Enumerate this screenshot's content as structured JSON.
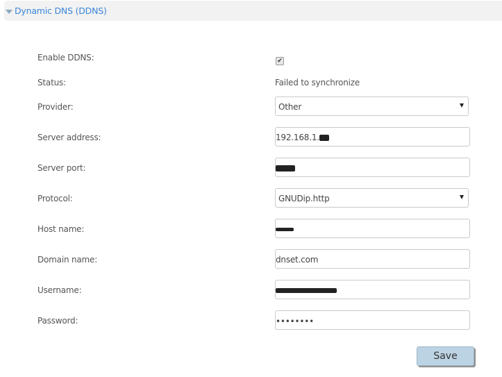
{
  "section": {
    "title": "Dynamic DNS (DDNS)",
    "expanded": true
  },
  "form": {
    "enable_ddns": {
      "label": "Enable DDNS:",
      "checked": true,
      "check_glyph": "✔"
    },
    "status": {
      "label": "Status:",
      "value": "Failed to synchronize"
    },
    "provider": {
      "label": "Provider:",
      "value": "Other"
    },
    "server_address": {
      "label": "Server address:",
      "value": "192.168.1.",
      "redacted_suffix": true
    },
    "server_port": {
      "label": "Server port:",
      "value": "",
      "redacted": true
    },
    "protocol": {
      "label": "Protocol:",
      "value": "GNUDip.http"
    },
    "host_name": {
      "label": "Host name:",
      "value": "",
      "redacted": true
    },
    "domain_name": {
      "label": "Domain name:",
      "value": "dnset.com"
    },
    "username": {
      "label": "Username:",
      "value": "",
      "redacted": true
    },
    "password": {
      "label": "Password:",
      "value": "••••••••"
    }
  },
  "actions": {
    "save_label": "Save"
  },
  "colors": {
    "accent": "#3b86d8",
    "header_bg": "#f2f2f2",
    "save_bg": "#bcd3e3"
  }
}
